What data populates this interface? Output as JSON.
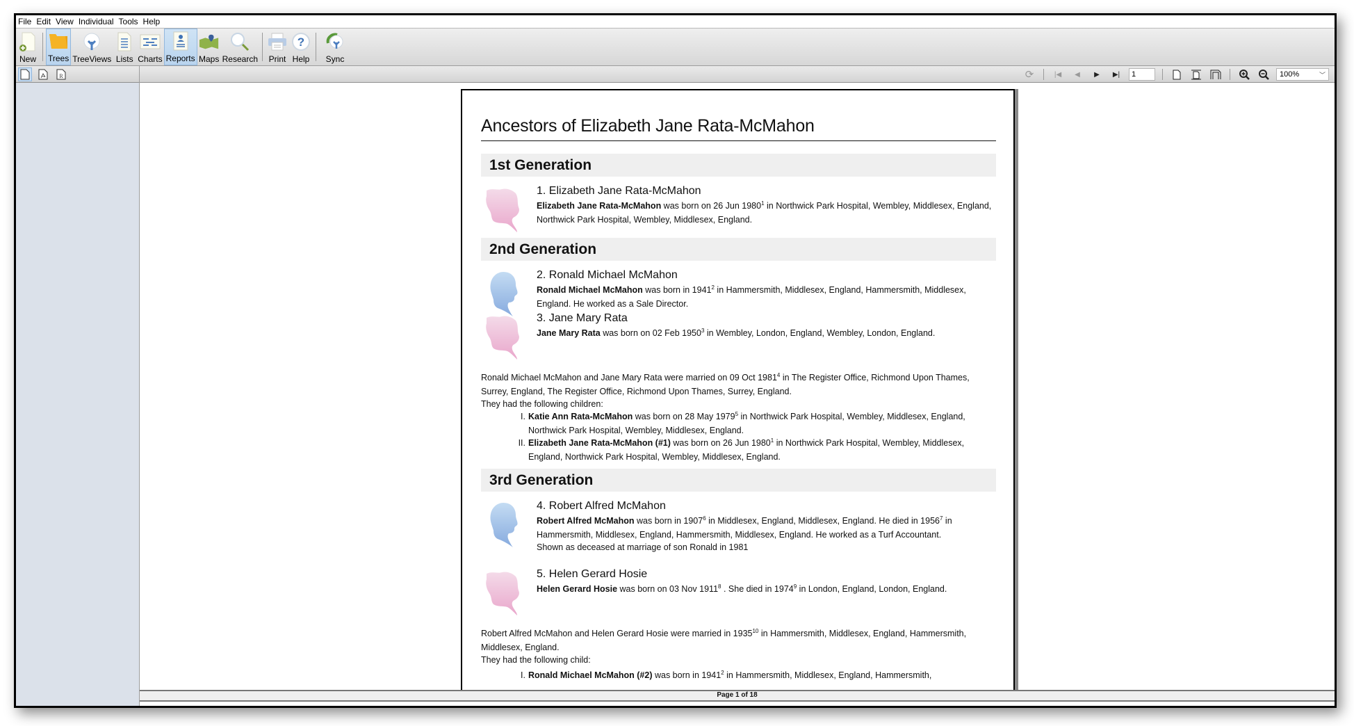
{
  "menu": [
    "File",
    "Edit",
    "View",
    "Individual",
    "Tools",
    "Help"
  ],
  "toolbar": {
    "new": "New",
    "trees": "Trees",
    "treeviews": "TreeViews",
    "lists": "Lists",
    "charts": "Charts",
    "reports": "Reports",
    "maps": "Maps",
    "research": "Research",
    "print": "Print",
    "help": "Help",
    "sync": "Sync",
    "active": [
      "Trees",
      "Reports"
    ]
  },
  "viewer_toolbar": {
    "page_number": "1",
    "zoom_level": "100%",
    "icons": [
      "refresh-icon",
      "first-page-icon",
      "previous-page-icon",
      "next-page-icon",
      "last-page-icon",
      "single-page-icon",
      "page-width-icon",
      "margins-icon",
      "zoom-in-icon",
      "zoom-out-icon"
    ]
  },
  "sidebar_tabs": [
    "report-document-icon",
    "pdf-icon",
    "rtf-icon"
  ],
  "status": "Page 1 of 18",
  "report": {
    "title": "Ancestors of Elizabeth Jane Rata-McMahon",
    "generations": [
      {
        "heading": "1st Generation",
        "people": [
          {
            "name": "1. Elizabeth Jane Rata-McMahon",
            "gender": "female",
            "bold": "Elizabeth Jane Rata-McMahon",
            "text1": " was born on 26 Jun 1980",
            "sup1": "1",
            "text2": " in Northwick Park Hospital, Wembley, Middlesex, England, Northwick Park Hospital, Wembley, Middlesex, England."
          }
        ]
      },
      {
        "heading": "2nd Generation",
        "people": [
          {
            "name": "2. Ronald Michael McMahon",
            "gender": "male",
            "bold": "Ronald Michael McMahon",
            "text1": " was born in 1941",
            "sup1": "2",
            "text2": " in Hammersmith, Middlesex, England, Hammersmith, Middlesex, England. He worked as a Sale Director."
          },
          {
            "name": "3. Jane Mary Rata",
            "gender": "female",
            "bold": "Jane Mary Rata",
            "text1": " was born on 02 Feb 1950",
            "sup1": "3",
            "text2": " in Wembley, London, England, Wembley, London, England."
          }
        ],
        "marriage": {
          "text1": "Ronald Michael McMahon and Jane Mary Rata were married on 09 Oct 1981",
          "sup": "4",
          "text2": " in The Register Office, Richmond Upon Thames, Surrey, England, The Register Office, Richmond Upon Thames, Surrey, England.",
          "children_intro": "They had the following children:"
        },
        "children": [
          {
            "num": "I.",
            "bold": "Katie Ann Rata-McMahon",
            "text1": " was born on 28 May 1979",
            "sup": "5",
            "text2": " in Northwick Park Hospital, Wembley, Middlesex, England, Northwick Park Hospital, Wembley, Middlesex, England."
          },
          {
            "num": "II.",
            "bold": "Elizabeth Jane Rata-McMahon (#1)",
            "text1": " was born on 26 Jun 1980",
            "sup": "1",
            "text2": " in Northwick Park Hospital, Wembley, Middlesex, England, Northwick Park Hospital, Wembley, Middlesex, England."
          }
        ]
      },
      {
        "heading": "3rd Generation",
        "people": [
          {
            "name": "4. Robert Alfred McMahon",
            "gender": "male",
            "bold": "Robert Alfred McMahon",
            "text1": " was born in 1907",
            "sup1": "6",
            "text2": " in Middlesex, England, Middlesex, England. He died in 1956",
            "sup2": "7",
            "text3": " in Hammersmith, Middlesex, England, Hammersmith, Middlesex, England. He worked as a Turf Accountant.",
            "note": "Shown as deceased at marriage of son Ronald in 1981"
          },
          {
            "name": "5. Helen Gerard Hosie",
            "gender": "female",
            "bold": "Helen Gerard Hosie",
            "text1": " was born on 03 Nov 1911",
            "sup1": "8",
            "text2": " . She died in 1974",
            "sup2": "9",
            "text3": " in London, England, London, England."
          }
        ],
        "marriage": {
          "text1": "Robert Alfred McMahon and Helen Gerard Hosie were married in 1935",
          "sup": "10",
          "text2": " in Hammersmith, Middlesex, England, Hammersmith, Middlesex, England.",
          "children_intro": "They had the following child:"
        },
        "children": [
          {
            "num": "I.",
            "bold": "Ronald Michael McMahon (#2)",
            "text1": " was born in 1941",
            "sup": "2",
            "text2": " in Hammersmith, Middlesex, England, Hammersmith,"
          }
        ]
      }
    ]
  },
  "colors": {
    "female_silhouette": "#eeb6d6",
    "male_silhouette": "#9fc1e8",
    "generation_band": "#efefef",
    "sidebar": "#dbe1ea"
  }
}
